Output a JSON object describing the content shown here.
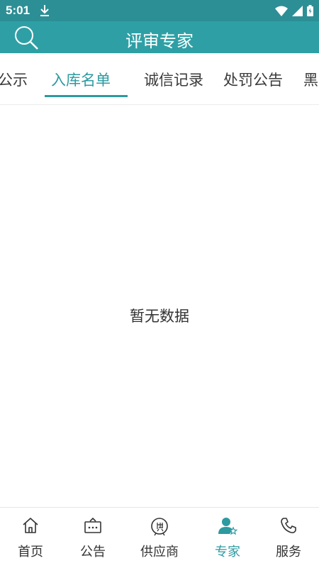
{
  "status_bar": {
    "time": "5:01"
  },
  "app_bar": {
    "title": "评审专家"
  },
  "tabs": [
    {
      "label": "公示"
    },
    {
      "label": "入库名单"
    },
    {
      "label": "诚信记录"
    },
    {
      "label": "处罚公告"
    },
    {
      "label": "黑"
    }
  ],
  "active_tab": "入库名单",
  "empty_text": "暂无数据",
  "bottom_nav": [
    {
      "label": "首页",
      "icon": "home-icon"
    },
    {
      "label": "公告",
      "icon": "announcement-icon"
    },
    {
      "label": "供应商",
      "icon": "supplier-icon"
    },
    {
      "label": "专家",
      "icon": "expert-icon"
    },
    {
      "label": "服务",
      "icon": "phone-icon"
    }
  ],
  "colors": {
    "primary": "#2ea0a5",
    "status_bar": "#2c8f95",
    "active": "#2c9aa0"
  }
}
